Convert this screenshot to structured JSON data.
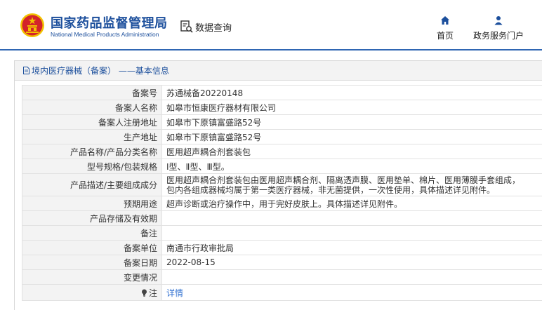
{
  "header": {
    "brand_cn": "国家药品监督管理局",
    "brand_en": "National Medical Products Administration",
    "data_query": "数据查询",
    "nav": {
      "home": "首页",
      "portal": "政务服务门户"
    },
    "colors": {
      "brand": "#1c4f9c",
      "accent": "#2f66b3",
      "emblem_red": "#d3232a",
      "emblem_gold": "#f2c200"
    }
  },
  "panel": {
    "title": "境内医疗器械（备案） ——基本信息"
  },
  "record": [
    {
      "key": "备案号",
      "value": "苏通械备20220148"
    },
    {
      "key": "备案人名称",
      "value": "如皋市恒康医疗器材有限公司"
    },
    {
      "key": "备案人注册地址",
      "value": "如皋市下原镇富盛路52号"
    },
    {
      "key": "生产地址",
      "value": "如皋市下原镇富盛路52号"
    },
    {
      "key": "产品名称/产品分类名称",
      "value": "医用超声耦合剂套装包"
    },
    {
      "key": "型号规格/包装规格",
      "value": "Ⅰ型、Ⅱ型、Ⅲ型。"
    },
    {
      "key": "产品描述/主要组成成分",
      "value_line1": "医用超声耦合剂套装包由医用超声耦合剂、隔离透声膜、医用垫单、棉片、医用薄膜手套组成，",
      "value_line2": "包内各组成器械均属于第一类医疗器械，非无菌提供，一次性使用，具体描述详见附件。"
    },
    {
      "key": "预期用途",
      "value": "超声诊断或治疗操作中，用于完好皮肤上。具体描述详见附件。"
    },
    {
      "key": "产品存储及有效期",
      "value": ""
    },
    {
      "key": "备注",
      "value": ""
    },
    {
      "key": "备案单位",
      "value": "南通市行政审批局"
    },
    {
      "key": "备案日期",
      "value": "2022-08-15"
    },
    {
      "key": "变更情况",
      "value": ""
    },
    {
      "key": "注",
      "value": "详情",
      "icon": "lightbulb-icon"
    }
  ]
}
